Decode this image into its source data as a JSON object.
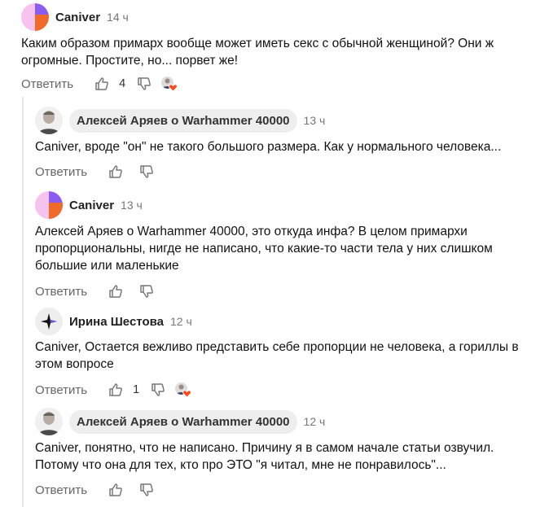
{
  "comments": [
    {
      "author": "Caniver",
      "time": "14 ч",
      "text": "Каким образом примарх вообще может иметь секс с обычной женщиной? Они ж огромные. Простите, но... порвет же!",
      "reply_label": "Ответить",
      "likes": "4"
    },
    {
      "author": "Алексей Аряев о Warhammer 40000",
      "time": "13 ч",
      "text": "Caniver, вроде \"он\" не такого большого размера. Как у нормального человека...",
      "reply_label": "Ответить"
    },
    {
      "author": "Caniver",
      "time": "13 ч",
      "text": "Алексей Аряев о Warhammer 40000, это откуда инфа? В целом примархи пропорциональны, нигде не написано, что какие-то части тела у них слишком большие или маленькие",
      "reply_label": "Ответить"
    },
    {
      "author": "Ирина Шестова",
      "time": "12 ч",
      "text": "Caniver, Остается вежливо представить себе пропорции не человека, а гориллы в этом вопросе",
      "reply_label": "Ответить",
      "likes": "1"
    },
    {
      "author": "Алексей Аряев о Warhammer 40000",
      "time": "12 ч",
      "text": "Caniver, понятно, что не написано. Причину я в самом начале статьи озвучил. Потому что она для тех, кто про ЭТО \"я читал, мне не понравилось\"...",
      "reply_label": "Ответить"
    }
  ],
  "colors": {
    "caniver_pink": "#f7c2ee",
    "caniver_purple": "#8a5cf0",
    "caniver_orange": "#f06a2a",
    "heart": "#ff4a1a"
  },
  "icons": {
    "like": "thumb-up-icon",
    "dislike": "thumb-down-icon",
    "liked_by": "heart-icon"
  }
}
